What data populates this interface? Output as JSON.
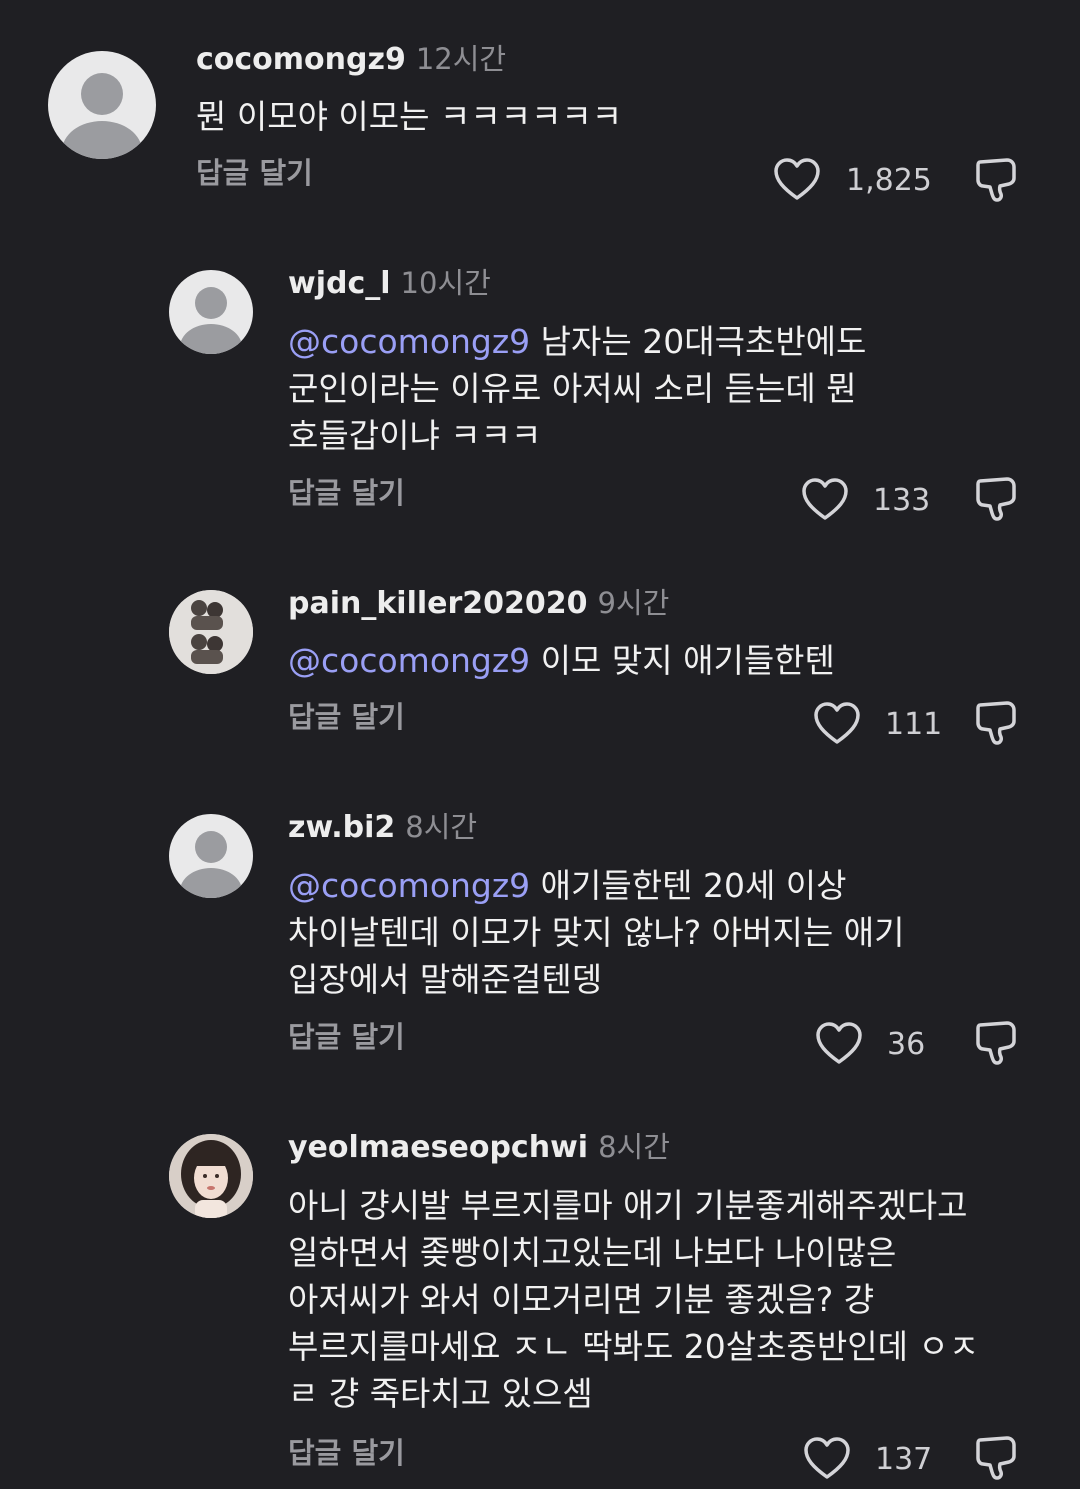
{
  "comments": [
    {
      "username": "cocomongz9",
      "time": "12시간",
      "text": "뭔 이모야 이모는 ㅋㅋㅋㅋㅋㅋ",
      "reply_label": "답글 달기",
      "likes": "1,825"
    },
    {
      "username": "wjdc_l",
      "time": "10시간",
      "mention": "@cocomongz9",
      "text_line1": " 남자는 20대극초반에도",
      "text_line2": "군인이라는 이유로 아저씨 소리 듣는데 뭔",
      "text_line3": "호들갑이냐 ㅋㅋㅋ",
      "reply_label": "답글 달기",
      "likes": "133"
    },
    {
      "username": "pain_killer202020",
      "time": "9시간",
      "mention": "@cocomongz9",
      "text_line1": " 이모 맞지 애기들한텐",
      "reply_label": "답글 달기",
      "likes": "111"
    },
    {
      "username": "zw.bi2",
      "time": "8시간",
      "mention": "@cocomongz9",
      "text_line1": " 애기들한텐 20세 이상",
      "text_line2": "차이날텐데 이모가 맞지 않나? 아버지는 애기",
      "text_line3": "입장에서 말해준걸텐뎅",
      "reply_label": "답글 달기",
      "likes": "36"
    },
    {
      "username": "yeolmaeseopchwi",
      "time": "8시간",
      "text_line1": "아니 걍시발 부르지를마 애기 기분좋게해주겠다고",
      "text_line2": "일하면서 좆빵이치고있는데 나보다 나이많은",
      "text_line3": "아저씨가 와서 이모거리면 기분 좋겠음? 걍",
      "text_line4": "부르지를마세요 ㅈㄴ 딱봐도 20살초중반인데 ㅇㅈ",
      "text_line5": "ㄹ 걍 죽타치고 있으셈",
      "reply_label": "답글 달기",
      "likes": "137"
    }
  ],
  "icons": {
    "like": "heart-icon",
    "dislike": "dislike-icon",
    "avatar": "default-avatar-icon"
  }
}
